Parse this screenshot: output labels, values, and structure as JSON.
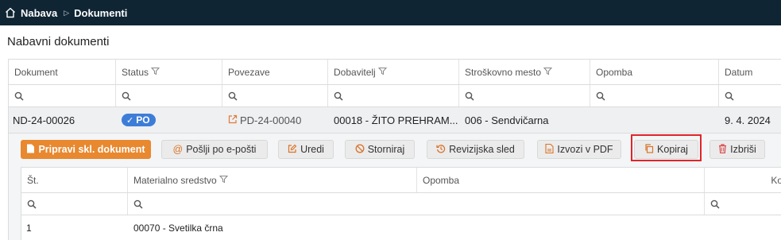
{
  "topbar": {
    "home_icon": "home-icon",
    "crumbs": [
      "Nabava",
      "Dokumenti"
    ],
    "separator_icon": "triangle-right-icon"
  },
  "page_title": "Nabavni dokumenti",
  "grid": {
    "columns": [
      "Dokument",
      "Status",
      "Povezave",
      "Dobavitelj",
      "Stroškovno mesto",
      "Opomba",
      "Datum"
    ],
    "row": {
      "dokument": "ND-24-00026",
      "status": "PO",
      "povezave": "PD-24-00040",
      "dobavitelj": "00018 - ŽITO PREHRAM...",
      "strosek": "006 - Sendvičarna",
      "opomba": "",
      "datum": "9. 4. 2024"
    }
  },
  "actions": {
    "pripravi": "Pripravi skl. dokument",
    "poslji": "Pošlji po e-pošti",
    "uredi": "Uredi",
    "storniraj": "Storniraj",
    "revizija": "Revizijska sled",
    "izvozi": "Izvozi v PDF",
    "kopiraj": "Kopiraj",
    "izbrisi": "Izbriši"
  },
  "subgrid": {
    "columns": [
      "Št.",
      "Materialno sredstvo",
      "Opomba",
      "Ko"
    ],
    "row": {
      "st": "1",
      "material": "00070 - Svetilka črna"
    }
  },
  "colors": {
    "topbar": "#0f2533",
    "primary": "#e8882f",
    "badge": "#3d7dd8",
    "highlight": "#e0252a"
  }
}
